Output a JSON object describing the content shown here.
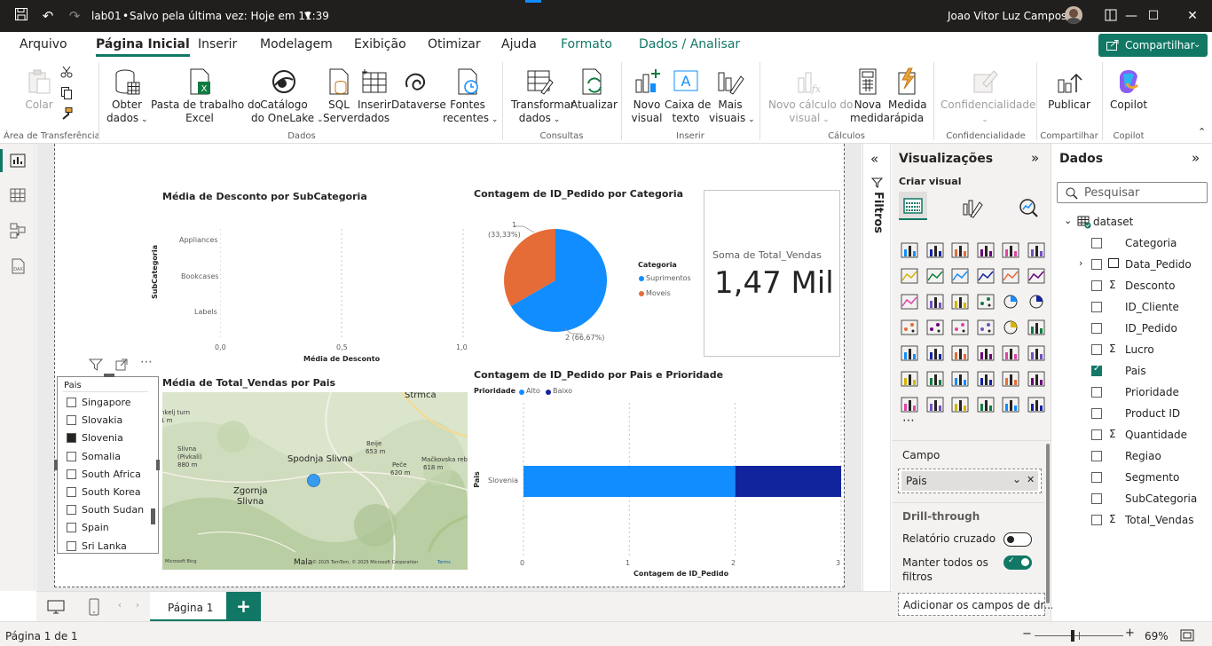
{
  "titlebar": {
    "file_name": "lab01",
    "save_status": "Salvo pela última vez: Hoje em 11:39",
    "user_name": "Joao Vitor Luz Campos"
  },
  "tabs": [
    {
      "label": "Arquivo"
    },
    {
      "label": "Página Inicial"
    },
    {
      "label": "Inserir"
    },
    {
      "label": "Modelagem"
    },
    {
      "label": "Exibição"
    },
    {
      "label": "Otimizar"
    },
    {
      "label": "Ajuda"
    },
    {
      "label": "Formato"
    },
    {
      "label": "Dados / Analisar"
    }
  ],
  "share_label": "Compartilhar",
  "ribbon": {
    "paste": "Colar",
    "clipboard_group": "Área de Transferência",
    "get_data": [
      "Obter",
      "dados"
    ],
    "excel": [
      "Pasta de trabalho do",
      "Excel"
    ],
    "onelake": [
      "Catálogo",
      "do OneLake"
    ],
    "sql": [
      "SQL",
      "Server"
    ],
    "enter_data": [
      "Inserir",
      "dados"
    ],
    "dataverse": "Dataverse",
    "recent": [
      "Fontes",
      "recentes"
    ],
    "data_group": "Dados",
    "transform": [
      "Transformar",
      "dados"
    ],
    "refresh": "Atualizar",
    "queries_group": "Consultas",
    "new_visual": [
      "Novo",
      "visual"
    ],
    "textbox": [
      "Caixa de",
      "texto"
    ],
    "more_visuals": [
      "Mais",
      "visuais"
    ],
    "insert_group": "Inserir",
    "new_calc": [
      "Novo cálculo do",
      "visual"
    ],
    "new_measure": [
      "Nova",
      "medida"
    ],
    "quick_measure": [
      "Medida",
      "rápida"
    ],
    "calc_group": "Cálculos",
    "sensitivity": "Confidencialidade",
    "sensitivity_group": "Confidencialidade",
    "publish": "Publicar",
    "share_group": "Compartilhar",
    "copilot": "Copilot",
    "copilot_group": "Copilot"
  },
  "bar_chart": {
    "title": "Média de Desconto por SubCategoria",
    "ylabel": "SubCategoria",
    "xlabel": "Média de Desconto",
    "categories": [
      "Appliances",
      "Bookcases",
      "Labels"
    ],
    "ticks": [
      "0,0",
      "0,5",
      "1,0"
    ]
  },
  "pie_chart": {
    "title": "Contagem de ID_Pedido por Categoria",
    "legend_title": "Categoria",
    "label1": "1",
    "label1b": "(33,33%)",
    "label2": "2 (66,67%)",
    "legend": [
      "Suprimentos",
      "Moveis"
    ]
  },
  "card": {
    "label": "Soma de Total_Vendas",
    "value": "1,47 Mil"
  },
  "slicer": {
    "header": "Pais",
    "items": [
      {
        "label": "Singapore",
        "checked": false
      },
      {
        "label": "Slovakia",
        "checked": false
      },
      {
        "label": "Slovenia",
        "checked": true
      },
      {
        "label": "Somalia",
        "checked": false
      },
      {
        "label": "South Africa",
        "checked": false
      },
      {
        "label": "South Korea",
        "checked": false
      },
      {
        "label": "South Sudan",
        "checked": false
      },
      {
        "label": "Spain",
        "checked": false
      },
      {
        "label": "Sri Lanka",
        "checked": false
      }
    ]
  },
  "map": {
    "title": "Média de Total_Vendas por Pais",
    "places": [
      "Strmca",
      "Spodnja Slivna",
      "Zgornja",
      "Slivna",
      "Beije",
      "653 m",
      "Peče",
      "620 m",
      "Mačkovska reb",
      "618 m",
      "Slivna",
      "(Pivkali)",
      "880 m",
      "nkelj turn",
      "1 m"
    ],
    "attribution": "© 2025 TomTom, © 2025 Microsoft Corporation",
    "terms": "Terms",
    "bing": "Microsoft Bing",
    "mala": "Mala"
  },
  "stacked_bar": {
    "title": "Contagem de ID_Pedido por Pais e Prioridade",
    "legend_title": "Prioridade",
    "legend": [
      "Alto",
      "Baixo"
    ],
    "category": "Slovenia",
    "ylabel": "Pais",
    "xlabel": "Contagem de ID_Pedido",
    "ticks": [
      "0",
      "1",
      "2",
      "3"
    ]
  },
  "chart_data": [
    {
      "type": "bar",
      "title": "Média de Desconto por SubCategoria",
      "categories": [
        "Appliances",
        "Bookcases",
        "Labels"
      ],
      "values": [
        0,
        0,
        0
      ],
      "xlabel": "Média de Desconto",
      "ylabel": "SubCategoria",
      "xlim": [
        0,
        1
      ]
    },
    {
      "type": "pie",
      "title": "Contagem de ID_Pedido por Categoria",
      "categories": [
        "Suprimentos",
        "Moveis"
      ],
      "values": [
        2,
        1
      ],
      "colors": [
        "#118dff",
        "#e66c37"
      ]
    },
    {
      "type": "bar",
      "title": "Contagem de ID_Pedido por Pais e Prioridade",
      "categories": [
        "Slovenia"
      ],
      "series": [
        {
          "name": "Alto",
          "values": [
            2
          ]
        },
        {
          "name": "Baixo",
          "values": [
            1
          ]
        }
      ],
      "xlabel": "Contagem de ID_Pedido",
      "ylabel": "Pais",
      "xlim": [
        0,
        3
      ],
      "colors": [
        "#118dff",
        "#12239e"
      ]
    }
  ],
  "filters_label": "Filtros",
  "viz_pane": {
    "title": "Visualizações",
    "build_label": "Criar visual",
    "field_label": "Campo",
    "field_value": "Pais",
    "drill_label": "Drill-through",
    "cross_report": "Relatório cruzado",
    "keep_filters": [
      "Manter todos os",
      "filtros"
    ],
    "add_fields": "Adicionar os campos de dr..."
  },
  "data_pane": {
    "title": "Dados",
    "search_placeholder": "Pesquisar",
    "table": "dataset",
    "fields": [
      {
        "label": "Categoria",
        "sigma": false,
        "checked": false
      },
      {
        "label": "Data_Pedido",
        "sigma": false,
        "checked": false
      },
      {
        "label": "Desconto",
        "sigma": true,
        "checked": false
      },
      {
        "label": "ID_Cliente",
        "sigma": false,
        "checked": false
      },
      {
        "label": "ID_Pedido",
        "sigma": false,
        "checked": false
      },
      {
        "label": "Lucro",
        "sigma": true,
        "checked": false
      },
      {
        "label": "Pais",
        "sigma": false,
        "checked": true
      },
      {
        "label": "Prioridade",
        "sigma": false,
        "checked": false
      },
      {
        "label": "Product ID",
        "sigma": false,
        "checked": false
      },
      {
        "label": "Quantidade",
        "sigma": true,
        "checked": false
      },
      {
        "label": "Regiao",
        "sigma": false,
        "checked": false
      },
      {
        "label": "Segmento",
        "sigma": false,
        "checked": false
      },
      {
        "label": "SubCategoria",
        "sigma": false,
        "checked": false
      },
      {
        "label": "Total_Vendas",
        "sigma": true,
        "checked": false
      }
    ]
  },
  "page_tab": "Página 1",
  "status": {
    "page_info": "Página 1 de 1",
    "zoom": "69%"
  },
  "colors": {
    "accent": "#117865",
    "blue": "#118dff",
    "orange": "#e66c37",
    "navy": "#12239e"
  }
}
